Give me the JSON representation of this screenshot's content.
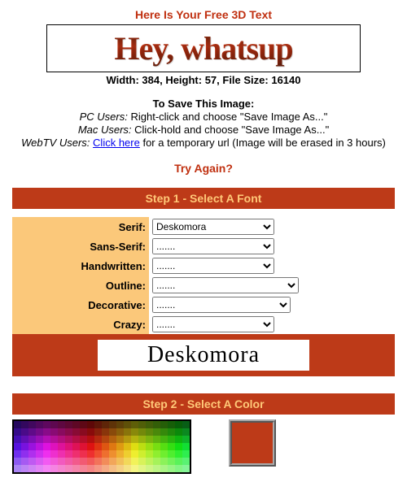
{
  "header": {
    "title": "Here Is Your Free 3D Text",
    "preview_text": "Hey, whatsup",
    "dimensions": "Width: 384, Height: 57, File Size: 16140"
  },
  "save": {
    "title": "To Save This Image:",
    "pc_prefix": "PC Users:",
    "pc_text": " Right-click and choose \"Save Image As...\"",
    "mac_prefix": "Mac Users:",
    "mac_text": " Click-hold and choose \"Save Image As...\"",
    "webtv_prefix": "WebTV Users:",
    "webtv_link": "Click here",
    "webtv_after": " for a temporary url (Image will be erased in 3 hours)"
  },
  "try_again": "Try Again?",
  "steps": {
    "step1": "Step 1 - Select A Font",
    "step2": "Step 2 - Select A Color"
  },
  "fonts": {
    "rows": [
      {
        "label": "Serif:",
        "value": "Deskomora"
      },
      {
        "label": "Sans-Serif:",
        "value": "......."
      },
      {
        "label": "Handwritten:",
        "value": "......."
      },
      {
        "label": "Outline:",
        "value": "......."
      },
      {
        "label": "Decorative:",
        "value": "......."
      },
      {
        "label": "Crazy:",
        "value": "......."
      }
    ],
    "preview": "Deskomora"
  },
  "color": {
    "selected": "#bd3a18"
  }
}
